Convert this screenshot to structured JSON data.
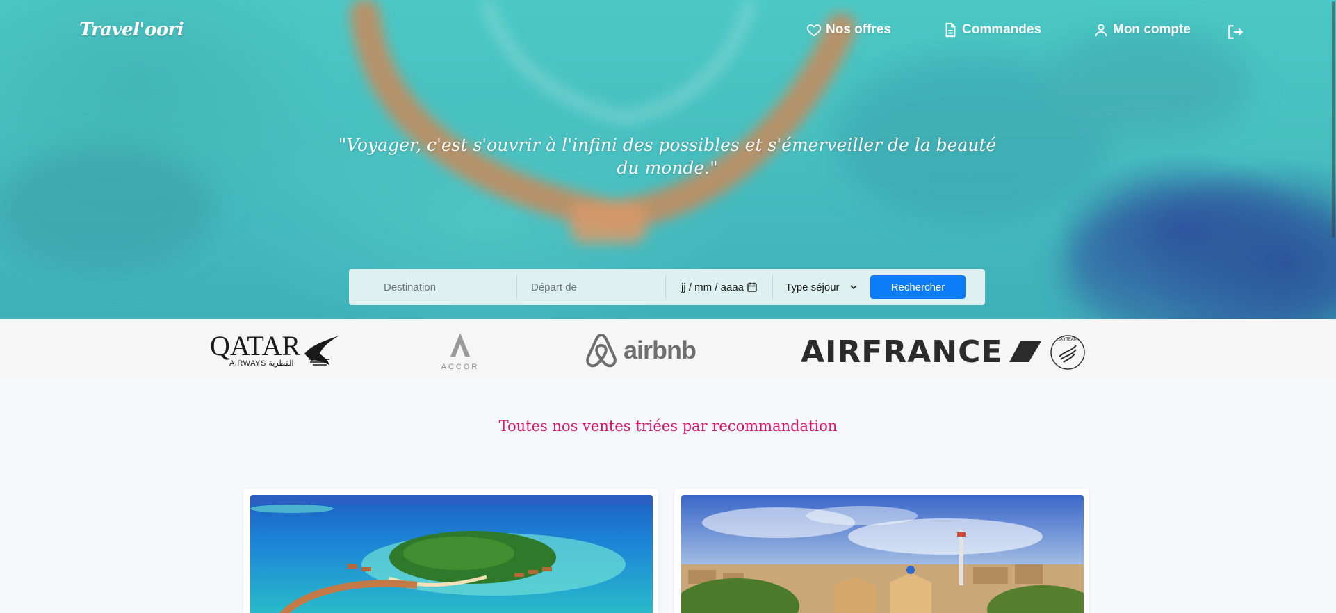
{
  "brand": {
    "logo": "Travel'oori"
  },
  "nav": {
    "items": [
      {
        "label": "Nos offres",
        "icon": "heart-icon"
      },
      {
        "label": "Commandes",
        "icon": "document-icon"
      },
      {
        "label": "Mon compte",
        "icon": "user-icon"
      }
    ],
    "logout_icon": "logout-icon"
  },
  "hero": {
    "quote": "\"Voyager, c'est s'ouvrir à l'infini des possibles et s'émerveiller de la beauté du monde.\""
  },
  "search": {
    "destination_placeholder": "Destination",
    "depart_placeholder": "Départ de",
    "date_placeholder": "jj / mm / aaaa",
    "type_selected": "Type séjour",
    "submit_label": "Rechercher"
  },
  "partners": {
    "qatar": {
      "word": "QATAR",
      "sub": "AIRWAYS القطرية"
    },
    "accor": "ACCOR",
    "airbnb": "airbnb",
    "airfrance": "AIRFRANCE",
    "skyteam": "SKYTEAM"
  },
  "section": {
    "title": "Toutes nos ventes triées par recommandation"
  },
  "colors": {
    "accent": "#0d7cf8",
    "title": "#d4146d",
    "hero": "#47bfc0"
  }
}
